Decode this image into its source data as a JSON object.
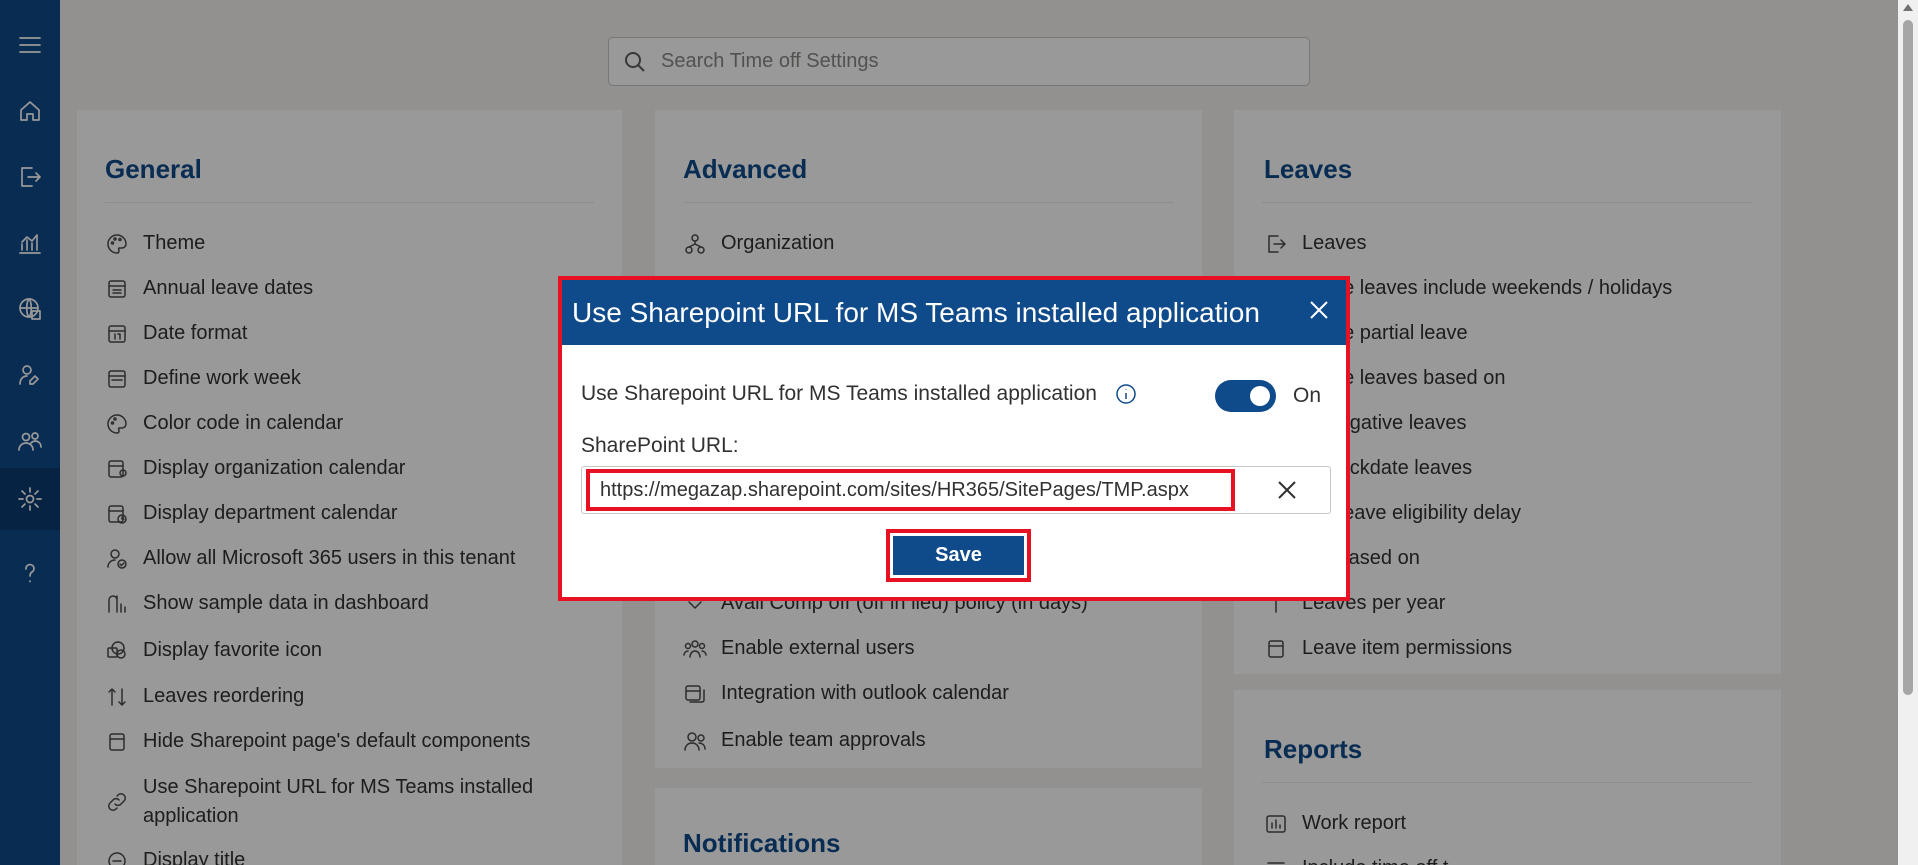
{
  "header": {
    "search_placeholder": "Search Time off Settings"
  },
  "general": {
    "title": "General",
    "items": [
      {
        "label": "Theme",
        "icon": "palette-icon"
      },
      {
        "label": "Annual leave dates",
        "icon": "calendar-dates-icon"
      },
      {
        "label": "Date format",
        "icon": "calendar-number-icon"
      },
      {
        "label": "Define work week",
        "icon": "calendar-week-icon"
      },
      {
        "label": "Color code in calendar",
        "icon": "palette-icon"
      },
      {
        "label": "Display organization calendar",
        "icon": "calendar-person-icon"
      },
      {
        "label": "Display department calendar",
        "icon": "calendar-clock-icon"
      },
      {
        "label": "Allow all Microsoft 365 users in this tenant",
        "icon": "person-check-icon"
      },
      {
        "label": "Show sample data in dashboard",
        "icon": "chart-data-icon"
      },
      {
        "label": "Display favorite icon",
        "icon": "sharepoint-icon"
      },
      {
        "label": "Leaves reordering",
        "icon": "sort-arrows-icon"
      },
      {
        "label": "Hide Sharepoint page's default components",
        "icon": "page-icon"
      },
      {
        "label": "Use Sharepoint URL for MS Teams installed application",
        "icon": "link-icon"
      },
      {
        "label": "Display title",
        "icon": "title-icon"
      }
    ]
  },
  "advanced": {
    "title": "Advanced",
    "items": [
      {
        "label": "Organization",
        "icon": "org-chart-icon"
      },
      {
        "label": "Avail Comp off (off in lieu) policy (in days)",
        "icon": "chevron-down-icon"
      },
      {
        "label": "Enable external users",
        "icon": "people-group-icon"
      },
      {
        "label": "Integration with outlook calendar",
        "icon": "calendar-sync-icon"
      },
      {
        "label": "Enable team approvals",
        "icon": "people-team-icon"
      }
    ]
  },
  "notifications": {
    "title": "Notifications"
  },
  "leaves": {
    "title": "Leaves",
    "items": [
      {
        "label": "Leaves",
        "icon": "leave-icon"
      },
      {
        "label": "…late leaves include weekends / holidays",
        "icon": "calculator-icon"
      },
      {
        "label": "…late partial leave",
        "icon": "calculator-icon"
      },
      {
        "label": "…late leaves based on",
        "icon": "calculator-icon"
      },
      {
        "label": "… negative leaves",
        "icon": "minus-icon"
      },
      {
        "label": "… backdate leaves",
        "icon": "history-icon"
      },
      {
        "label": "…e leave eligibility delay",
        "icon": "clock-icon"
      },
      {
        "label": "…s based on",
        "icon": "calculator-icon"
      },
      {
        "label": "Leaves per year",
        "icon": "number-icon"
      },
      {
        "label": "Leave item permissions",
        "icon": "lock-page-icon"
      }
    ]
  },
  "reports": {
    "title": "Reports",
    "items": [
      {
        "label": "Work report",
        "icon": "report-icon"
      },
      {
        "label": "Include time off t…",
        "icon": "table-icon"
      }
    ]
  },
  "dialog": {
    "title": "Use Sharepoint URL for MS Teams installed application",
    "setting_label": "Use Sharepoint URL for MS Teams installed application",
    "toggle_state": "On",
    "toggle_on": true,
    "url_label": "SharePoint URL:",
    "url_value": "https://megazap.sharepoint.com/sites/HR365/SitePages/TMP.aspx",
    "save_label": "Save"
  },
  "colors": {
    "brand": "#0f4a8a",
    "highlight": "#e81123"
  }
}
